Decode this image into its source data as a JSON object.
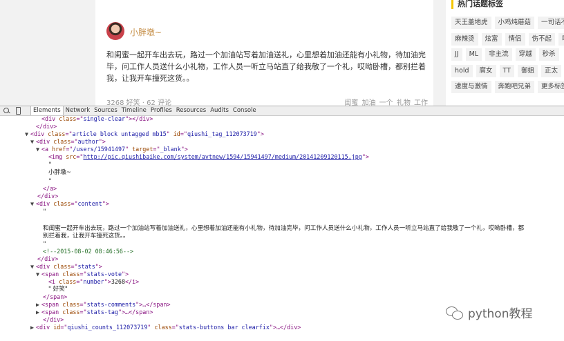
{
  "article": {
    "author_name": "小胖墩~",
    "content": "和闺蜜一起开车出去玩，路过一个加油站写着加油送礼，心里想着加油还能有小礼物，待加油完毕，问工作人员送什么小礼物，工作人员一听立马站直了给我敬了一个礼，哎呦卧槽，都别拦着我，让我开车撞死这货。。",
    "stats": "3268 好笑 · 62 评论",
    "tags": "闺蜜 加油 一个 礼物 工作"
  },
  "sidebar": {
    "title": "热门话题标签",
    "tag_rows": [
      [
        "天王盖地虎",
        "小鸡炖蘑菇",
        "一司话不"
      ],
      [
        "麻辣烫",
        "炫富",
        "情侣",
        "伤不起",
        "吐"
      ],
      [
        "JJ",
        "ML",
        "非主流",
        "穿越",
        "秒杀"
      ],
      [
        "hold",
        "腐女",
        "TT",
        "御姐",
        "正太"
      ],
      [
        "速度与激情",
        "奔跑吧兄弟",
        "更多标签"
      ]
    ]
  },
  "devtools": {
    "tabs": [
      "Elements",
      "Network",
      "Sources",
      "Timeline",
      "Profiles",
      "Resources",
      "Audits",
      "Console"
    ],
    "active_tab": "Elements",
    "code": {
      "l1_cls": "single-clear",
      "l2": "</div>",
      "l3_cls": "article block untagged mb15",
      "l3_id": "qiushi_tag_112073719",
      "l4_cls": "author",
      "l5_href": "/users/15941497",
      "l5_target": "_blank",
      "l6_src": "http://pic.qiushibaike.com/system/avtnew/1594/15941497/medium/20141209120115.jpg",
      "l7": "\"",
      "l8": "小胖墩~",
      "l9": "\"",
      "l10": "</a>",
      "l11": "</div>",
      "l12_cls": "content",
      "l13": "\"",
      "l14": "和闺蜜一起开车出去玩，路过一个加油站写着加油送礼，心里想着加油还能有小礼物，待加油完毕，问工作人员送什么小礼物，工作人员一听立马站直了给我敬了一个礼，哎呦卧槽，都",
      "l15": "别拦着我，让我开车撞死这货。。",
      "l16": "\"",
      "l17": "<!--2015-08-02 08:46:56-->",
      "l18": "</div>",
      "l19_cls": "stats",
      "l20_cls": "stats-vote",
      "l21_cls": "number",
      "l21_val": "3268",
      "l22": "\" 好笑\"",
      "l23": "</span>",
      "l24_cls": "stats-comments",
      "l25_cls": "stats-tag",
      "l26": "</div>",
      "l27_id": "qiushi_counts_112073719",
      "l27_cls": "stats-buttons bar clearfix"
    }
  },
  "watermark": "python教程"
}
